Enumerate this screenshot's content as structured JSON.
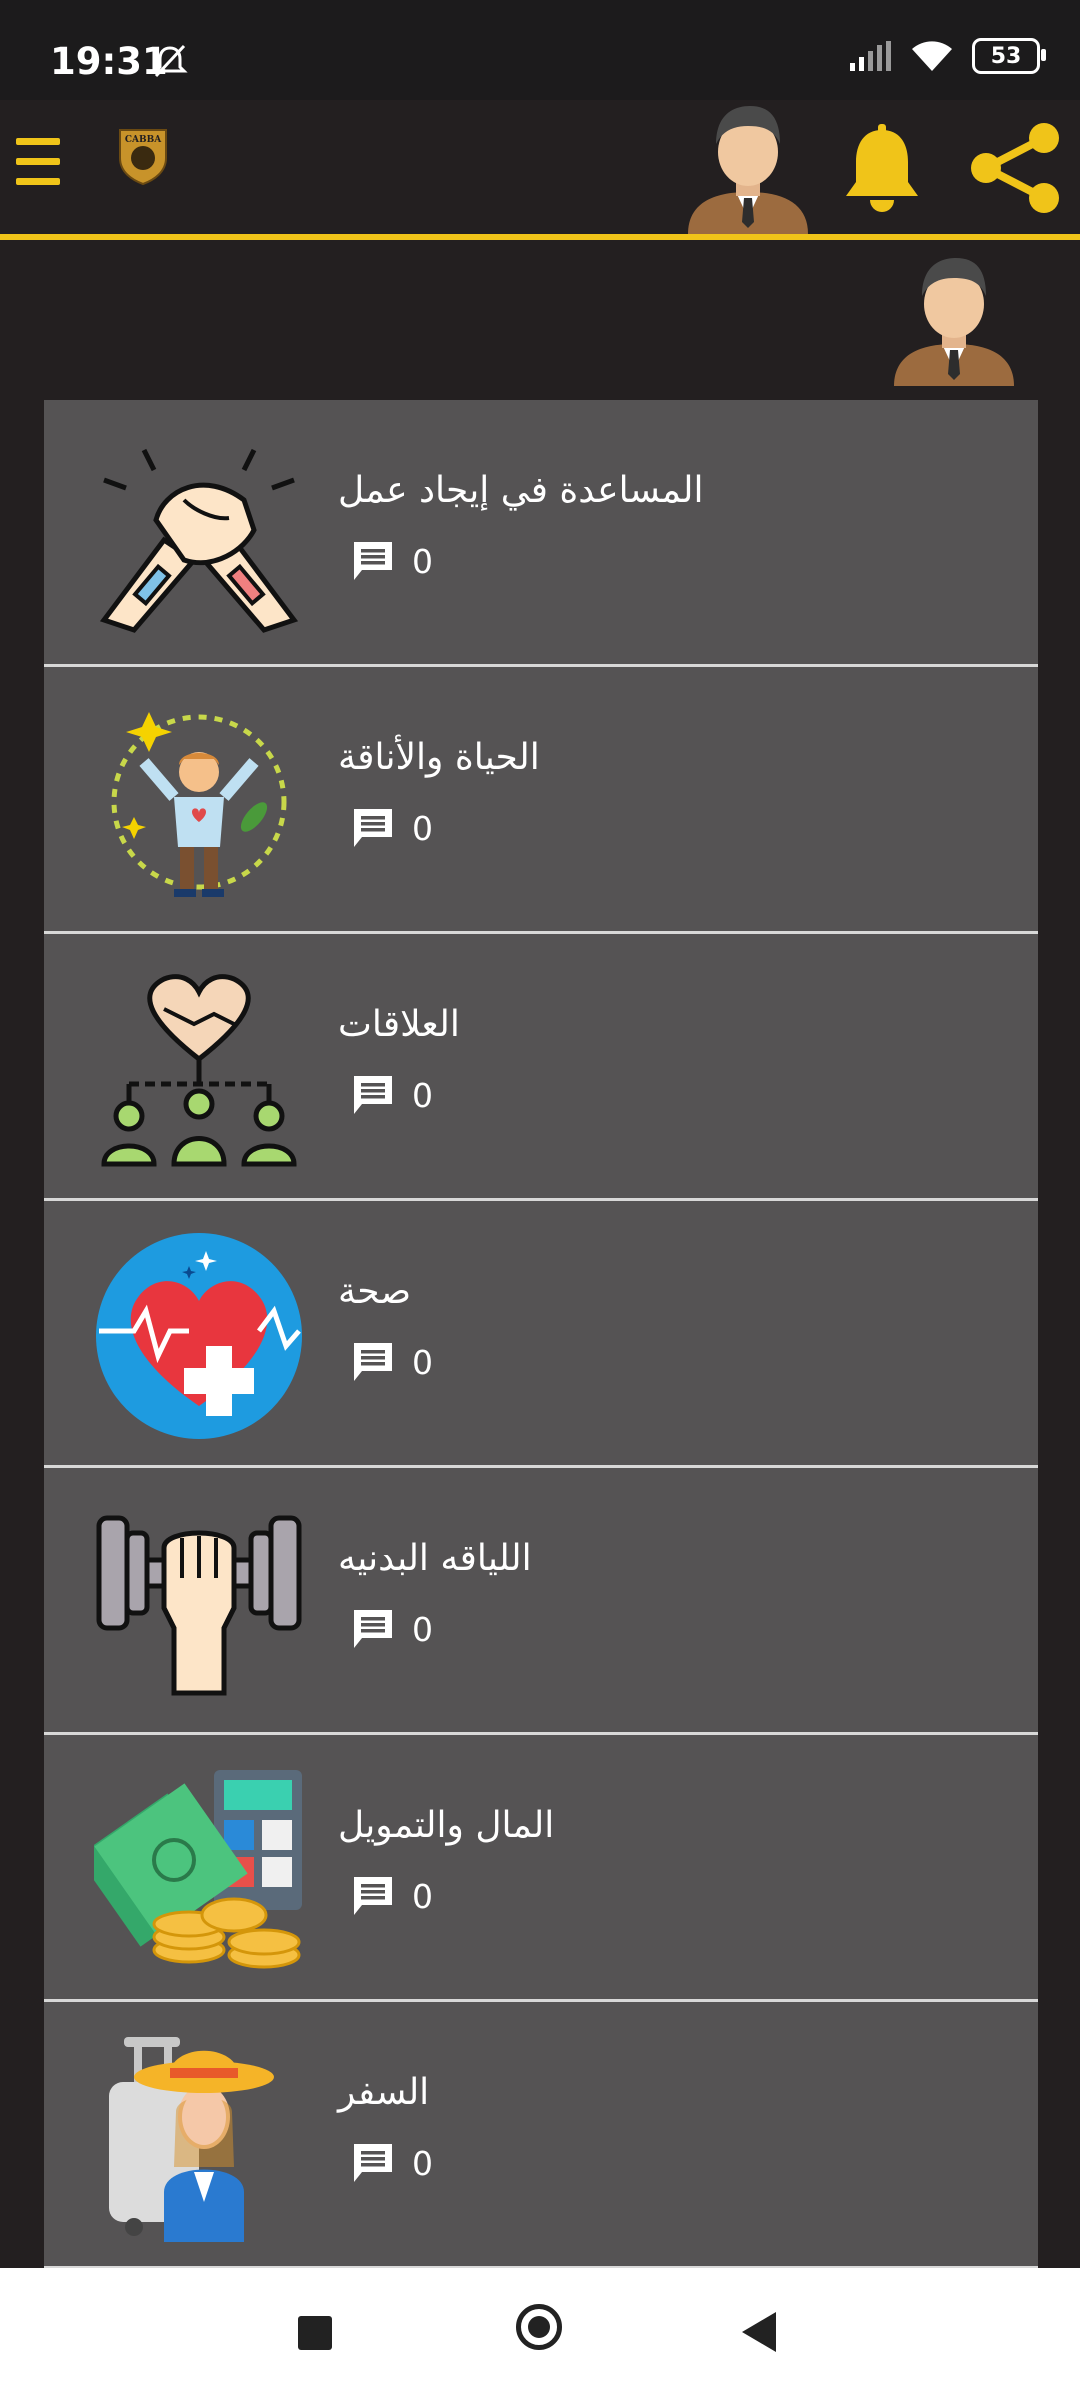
{
  "status_bar": {
    "time": "19:31",
    "battery": "53",
    "icons": [
      "mute-icon",
      "signal-icon",
      "wifi-icon",
      "battery-icon"
    ]
  },
  "app_bar": {
    "logo_text": "CABBA",
    "icons": [
      "menu-icon",
      "logo",
      "avatar-icon",
      "bell-icon",
      "share-icon"
    ],
    "accent_color": "#f0c419"
  },
  "categories": [
    {
      "title": "المساعدة في إيجاد عمل",
      "comments": "0",
      "icon": "handshake-icon"
    },
    {
      "title": "الحياة والأناقة",
      "comments": "0",
      "icon": "lifestyle-icon"
    },
    {
      "title": "العلاقات",
      "comments": "0",
      "icon": "relationships-icon"
    },
    {
      "title": "صحة",
      "comments": "0",
      "icon": "health-heart-icon"
    },
    {
      "title": "اللياقه البدنيه",
      "comments": "0",
      "icon": "dumbbell-icon"
    },
    {
      "title": "المال والتمويل",
      "comments": "0",
      "icon": "money-icon"
    },
    {
      "title": "السفر",
      "comments": "0",
      "icon": "travel-icon"
    }
  ],
  "colors": {
    "background": "#231f20",
    "card": "#555354",
    "accent": "#f0c419"
  }
}
